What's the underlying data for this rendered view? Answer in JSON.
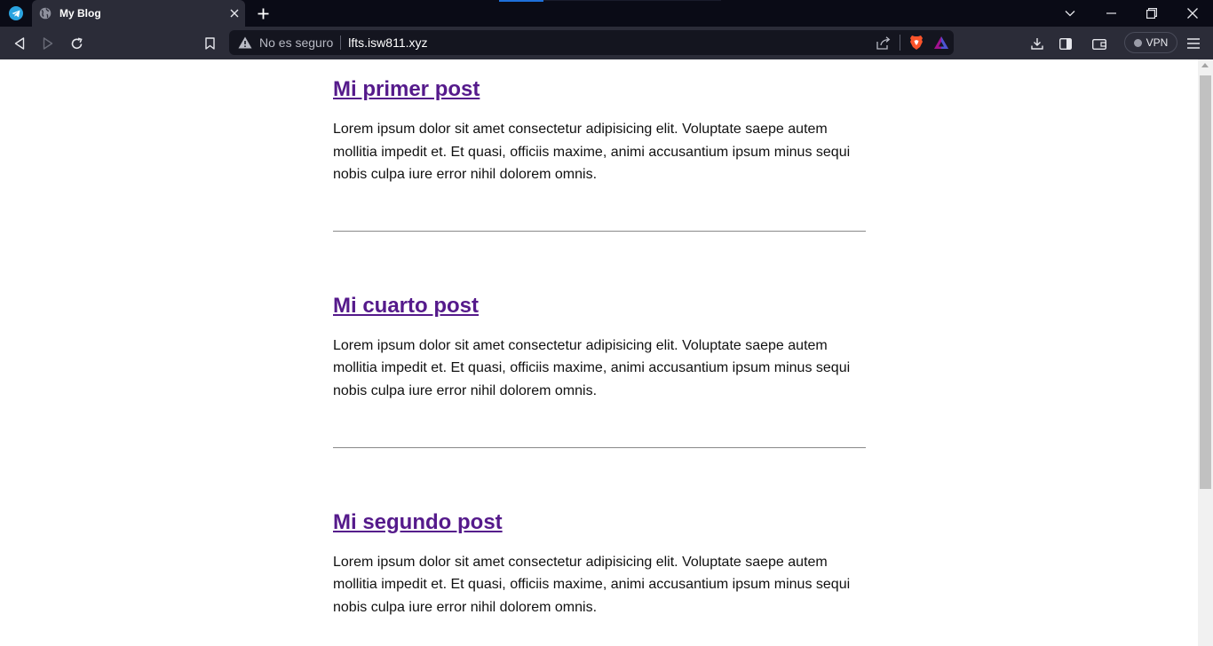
{
  "tab": {
    "title": "My Blog"
  },
  "toolbar": {
    "security_label": "No es seguro",
    "url": "lfts.isw811.xyz",
    "vpn_label": "VPN"
  },
  "icons": {
    "pinned": "telegram-icon",
    "tab_favicon": "globe-icon",
    "back": "back-icon",
    "forward": "forward-icon",
    "reload": "reload-icon",
    "bookmark": "bookmark-icon",
    "warning": "warning-icon",
    "share": "share-icon",
    "brave": "brave-shields-icon",
    "rewards": "brave-rewards-icon",
    "download": "download-icon",
    "sidebar": "sidebar-icon",
    "wallet": "wallet-icon",
    "menu": "menu-icon"
  },
  "colors": {
    "link_visited": "#551a8b",
    "chrome_dark": "#0a0b16",
    "toolbar": "#2b2c38",
    "urlbar": "#14151f"
  },
  "posts": [
    {
      "title": "Mi primer post",
      "body": "Lorem ipsum dolor sit amet consectetur adipisicing elit. Voluptate saepe autem mollitia impedit et. Et quasi, officiis maxime, animi accusantium ipsum minus sequi nobis culpa iure error nihil dolorem omnis."
    },
    {
      "title": "Mi cuarto post",
      "body": "Lorem ipsum dolor sit amet consectetur adipisicing elit. Voluptate saepe autem mollitia impedit et. Et quasi, officiis maxime, animi accusantium ipsum minus sequi nobis culpa iure error nihil dolorem omnis."
    },
    {
      "title": "Mi segundo post",
      "body": "Lorem ipsum dolor sit amet consectetur adipisicing elit. Voluptate saepe autem mollitia impedit et. Et quasi, officiis maxime, animi accusantium ipsum minus sequi nobis culpa iure error nihil dolorem omnis."
    }
  ]
}
